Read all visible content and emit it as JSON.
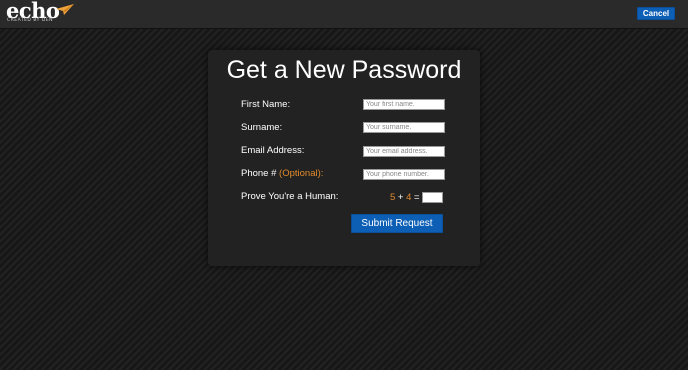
{
  "header": {
    "logo_text": "echo",
    "logo_subtext": "CREATED BY DEN",
    "cancel_label": "Cancel"
  },
  "form": {
    "title": "Get a New Password",
    "first_name": {
      "label": "First Name:",
      "placeholder": "Your first name."
    },
    "surname": {
      "label": "Surname:",
      "placeholder": "Your surname."
    },
    "email": {
      "label": "Email Address:",
      "placeholder": "Your email address."
    },
    "phone": {
      "label": "Phone # ",
      "optional": "(Optional):",
      "placeholder": "Your phone number."
    },
    "captcha": {
      "label": "Prove You're a Human:",
      "a": "5",
      "op": " + ",
      "b": "4",
      "eq": " =",
      "answer": ""
    },
    "submit_label": "Submit Request"
  },
  "colors": {
    "accent_orange": "#e38b2c",
    "button_blue": "#0d5fb5",
    "panel_bg": "#222222"
  }
}
